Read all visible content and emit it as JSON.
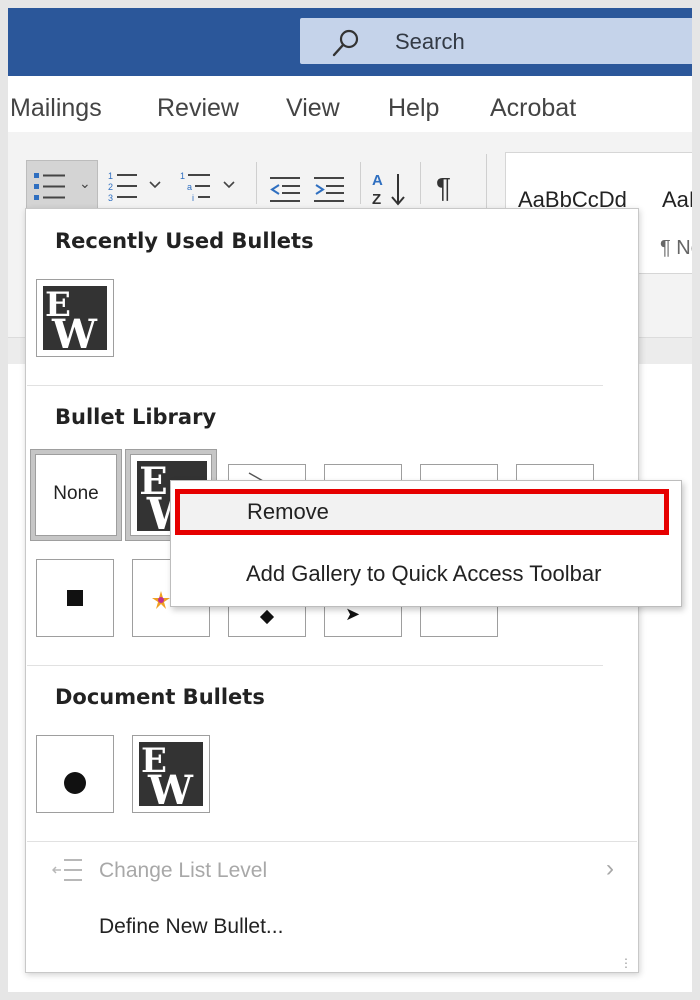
{
  "titlebar": {
    "search": {
      "placeholder": "Search",
      "icon": "search-icon"
    },
    "color": "#2b579a"
  },
  "ribbon_tabs": [
    "Mailings",
    "Review",
    "View",
    "Help",
    "Acrobat"
  ],
  "toolbar": {
    "icons": [
      "bullets-icon",
      "numbering-icon",
      "multilevel-list-icon",
      "decrease-indent-icon",
      "increase-indent-icon",
      "sort-icon",
      "show-formatting-icon"
    ],
    "styles": {
      "sample1": "AaBbCcDd",
      "sample2": "AaB",
      "style_name": "¶ No"
    }
  },
  "bullet_menu": {
    "recently_used_title": "Recently Used Bullets",
    "library_title": "Bullet Library",
    "none_label": "None",
    "document_bullets_title": "Document Bullets",
    "change_list_level": "Change List Level",
    "define_new_bullet": "Define New Bullet..."
  },
  "context_menu": {
    "remove": "Remove",
    "add_to_qat": "Add Gallery to Quick Access Toolbar",
    "highlight_color": "#e60000"
  }
}
